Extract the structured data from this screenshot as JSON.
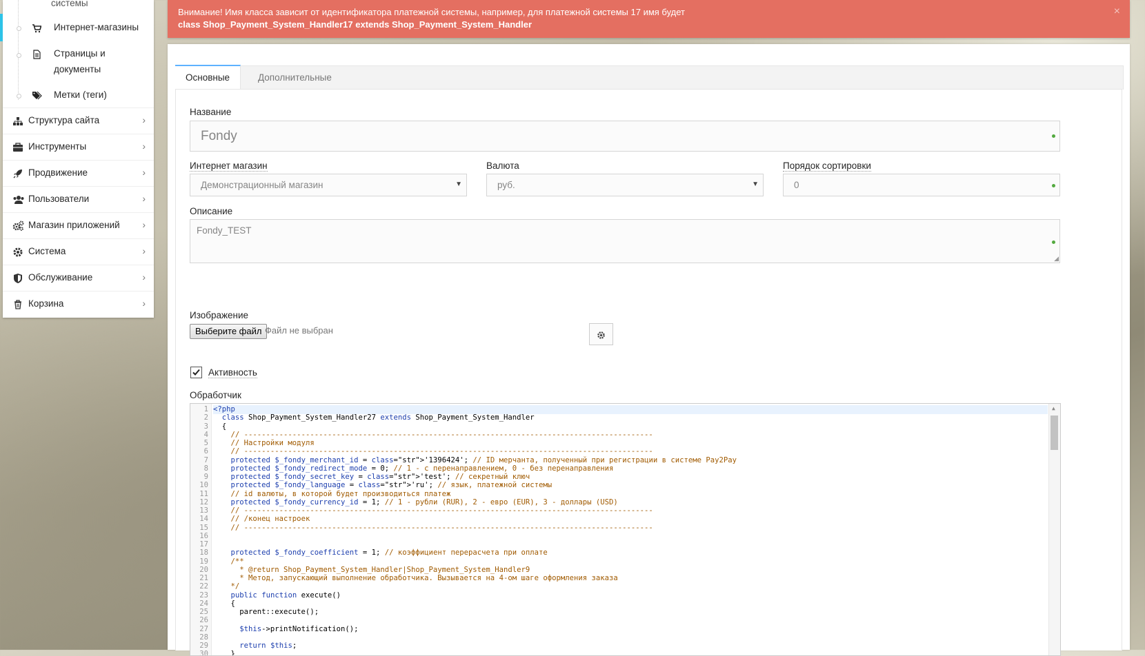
{
  "sidebar": {
    "sub_items": [
      {
        "label": "системы",
        "icon": "none"
      },
      {
        "label": "Интернет-магазины",
        "icon": "cart-icon"
      },
      {
        "label": "Страницы и",
        "label2": "документы",
        "icon": "file-icon"
      },
      {
        "label": "Метки (теги)",
        "icon": "tags-icon"
      }
    ],
    "menu": [
      {
        "label": "Структура сайта",
        "icon": "sitemap-icon"
      },
      {
        "label": "Инструменты",
        "icon": "briefcase-icon"
      },
      {
        "label": "Продвижение",
        "icon": "rocket-icon"
      },
      {
        "label": "Пользователи",
        "icon": "users-icon"
      },
      {
        "label": "Магазин приложений",
        "icon": "cogs-icon"
      },
      {
        "label": "Система",
        "icon": "gear-icon"
      },
      {
        "label": "Обслуживание",
        "icon": "shield-icon"
      },
      {
        "label": "Корзина",
        "icon": "trash-icon"
      }
    ],
    "chevron": "›"
  },
  "alert": {
    "line1": "Внимание! Имя класса зависит от идентификатора платежной системы, например, для платежной системы 17 имя будет",
    "line2": "class Shop_Payment_System_Handler17 extends Shop_Payment_System_Handler",
    "close": "×",
    "color": "#e46f61"
  },
  "tabs": [
    "Основные",
    "Дополнительные"
  ],
  "form": {
    "name_label": "Название",
    "name_value": "Fondy",
    "shop_label": "Интернет магазин",
    "shop_value": "Демонстрационный магазин",
    "currency_label": "Валюта",
    "currency_value": "руб.",
    "sort_label": "Порядок сортировки",
    "sort_value": "0",
    "desc_label": "Описание",
    "desc_value": "Fondy_TEST",
    "image_label": "Изображение",
    "file_button": "Выберите файл",
    "file_none": "Файл не выбран",
    "active_label": "Активность",
    "active_checked": true,
    "handler_label": "Обработчик"
  },
  "code_lines": [
    "<?php",
    "  class Shop_Payment_System_Handler27 extends Shop_Payment_System_Handler",
    "  {",
    "    // ---------------------------------------------------------------------------------------------",
    "    // Настройки модуля",
    "    // ---------------------------------------------------------------------------------------------",
    "    protected $_fondy_merchant_id = '1396424'; // ID мерчанта, полученный при регистрации в системе Pay2Pay",
    "    protected $_fondy_redirect_mode = 0; // 1 - с перенаправлением, 0 - без перенаправления",
    "    protected $_fondy_secret_key = 'test'; // секретный ключ",
    "    protected $_fondy_language = 'ru'; // язык, платежной системы",
    "    // id валюты, в которой будет производиться платеж",
    "    protected $_fondy_currency_id = 1; // 1 - рубли (RUR), 2 - евро (EUR), 3 - доллары (USD)",
    "    // ---------------------------------------------------------------------------------------------",
    "    // /конец настроек",
    "    // ---------------------------------------------------------------------------------------------",
    "",
    "",
    "    protected $_fondy_coefficient = 1; // коэффициент перерасчета при оплате",
    "    /**",
    "      * @return Shop_Payment_System_Handler|Shop_Payment_System_Handler9",
    "      * Метод, запускающий выполнение обработчика. Вызывается на 4-ом шаге оформления заказа",
    "    */",
    "    public function execute()",
    "    {",
    "      parent::execute();",
    "",
    "      $this->printNotification();",
    "",
    "      return $this;",
    "    }"
  ]
}
